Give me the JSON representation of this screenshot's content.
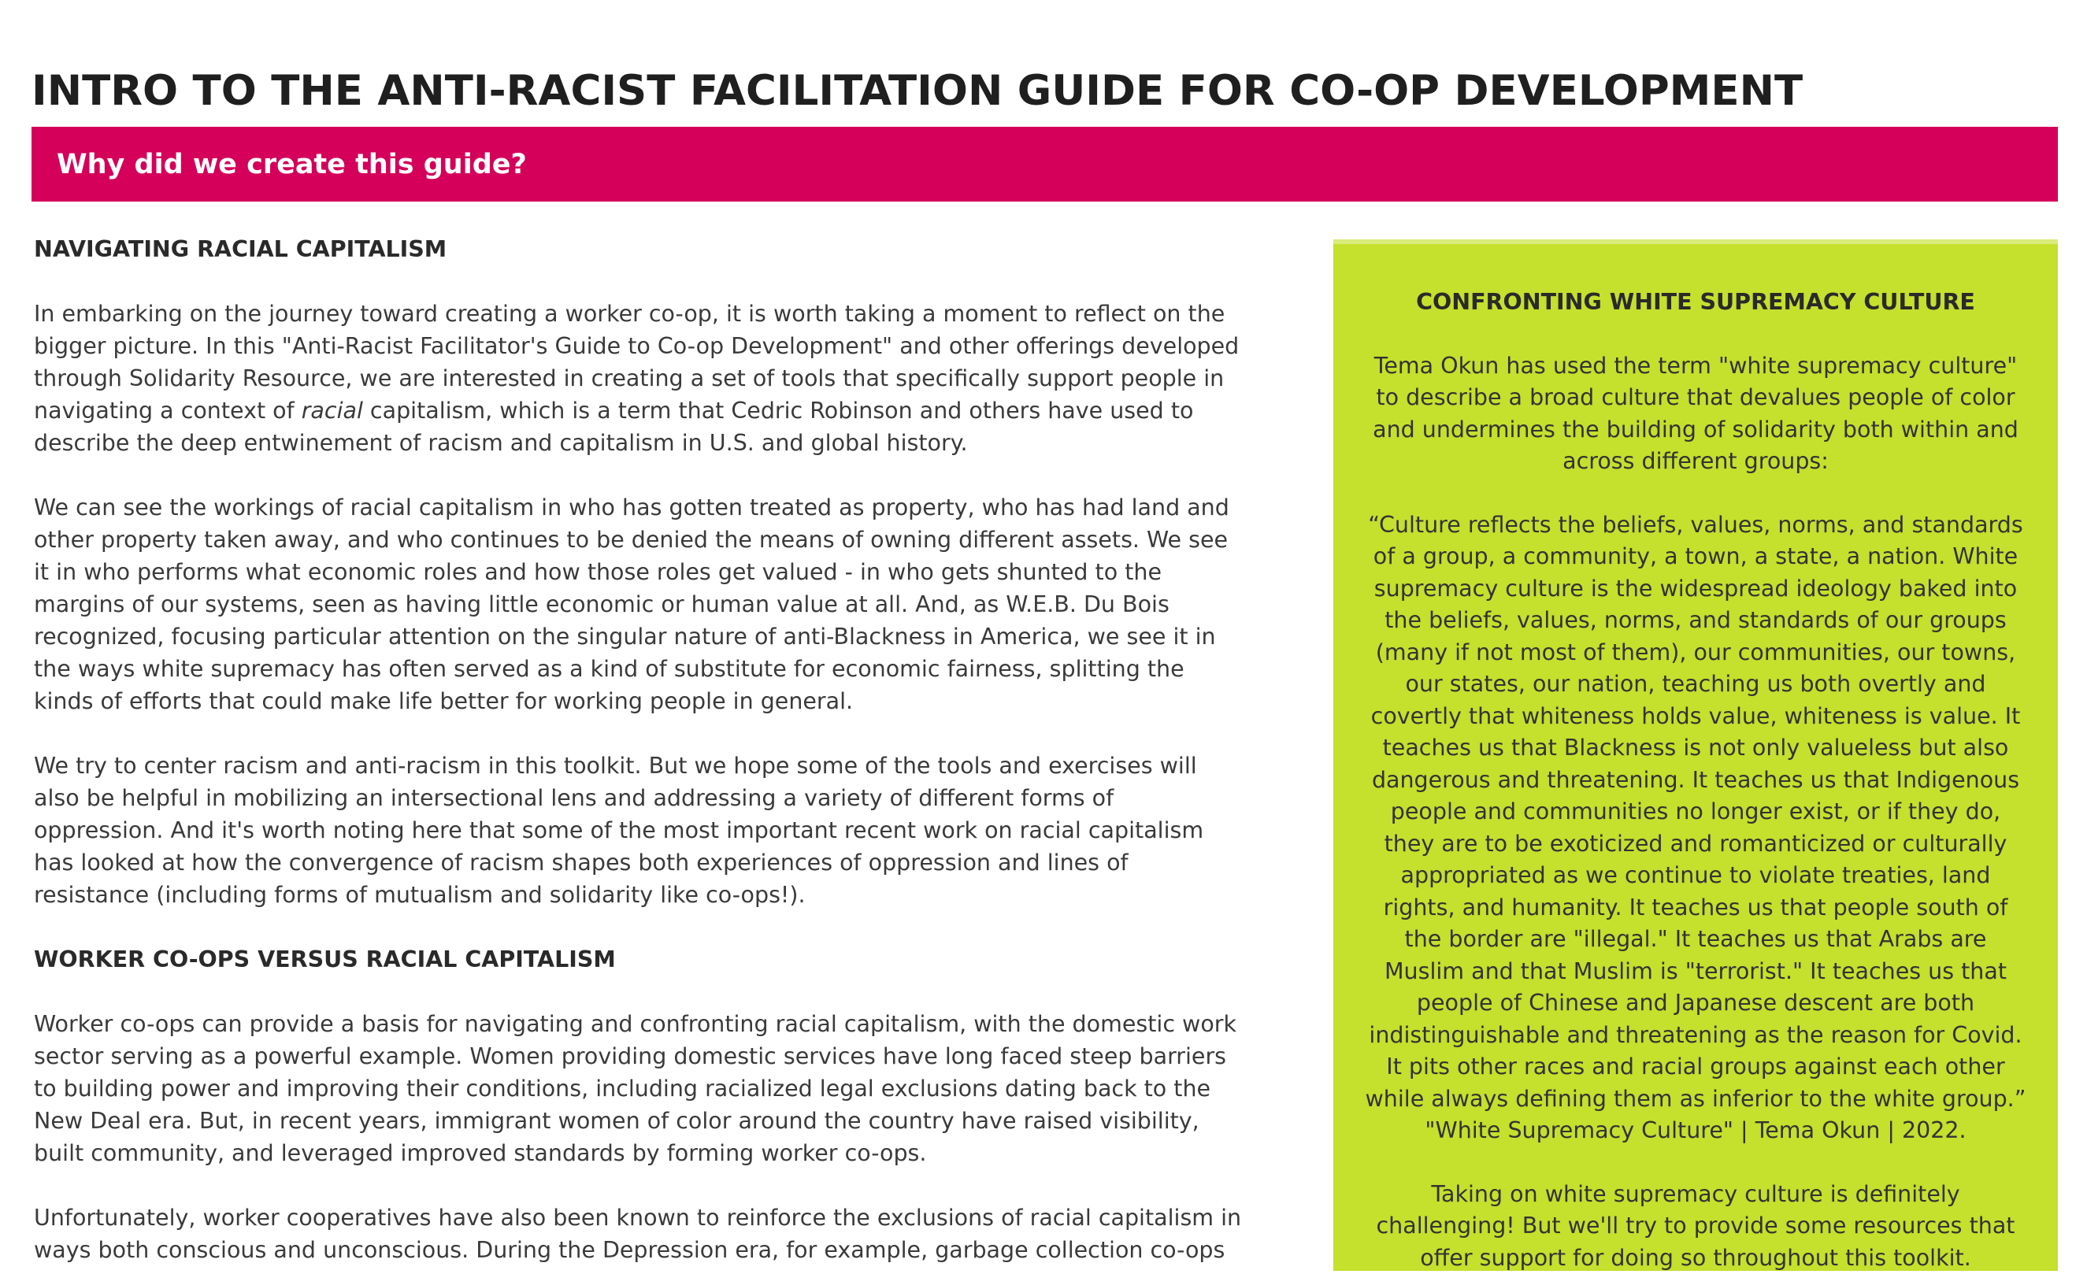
{
  "document": {
    "title": "INTRO TO THE ANTI-RACIST FACILITATION GUIDE FOR CO-OP DEVELOPMENT",
    "banner": "Why did we create this guide?",
    "colors": {
      "banner": "#d4005a",
      "sidebar": "#c5e02d"
    }
  },
  "main": {
    "heading1": "NAVIGATING RACIAL CAPITALISM",
    "p1_before": "In embarking on the journey toward creating a worker co-op, it is worth taking a moment to reflect on the bigger picture. In this \"Anti-Racist Facilitator's Guide to Co-op Development\" and other offerings developed through Solidarity Resource, we are interested in creating a set of tools that specifically support people in navigating a context of ",
    "p1_italic": "racial",
    "p1_after": " capitalism, which is a term that Cedric Robinson and others have used to describe the deep entwinement of racism and capitalism in U.S. and global history.",
    "p2": "We can see the workings of racial capitalism in who has gotten treated as property, who has had land and other property taken away, and who continues to be denied the means of owning different assets. We see it in who performs what economic roles and how those roles get valued - in who gets shunted to the margins of our systems, seen as having little economic or human value at all. And, as W.E.B. Du Bois recognized, focusing particular attention on the singular nature of anti-Blackness in America, we see it in the ways white supremacy has often served as a kind of substitute for economic fairness, splitting the kinds of efforts that could make life better for working people in general.",
    "p3": "We try to center racism and anti-racism in this toolkit. But we hope some of the tools and exercises will also be helpful in mobilizing an intersectional lens and addressing a variety of different forms of oppression. And it's worth noting here that some of the most important recent work on racial capitalism has looked at how the convergence of racism shapes both experiences of oppression and lines of resistance (including forms of mutualism and solidarity like co-ops!).",
    "heading2": "WORKER CO-OPS VERSUS RACIAL CAPITALISM",
    "p4": "Worker co-ops can provide a basis for navigating and confronting racial capitalism, with the domestic work sector serving as a powerful example. Women providing domestic services have long faced steep barriers to building power and improving their conditions, including racialized legal exclusions dating back to the New Deal era. But, in recent years, immigrant women of color around the country have raised visibility, built community, and leveraged improved standards by forming  worker co-ops.",
    "p5": "Unfortunately, worker cooperatives have also been known to reinforce the exclusions of racial capitalism in ways both conscious and unconscious. During the Depression era, for example, garbage collection co-ops"
  },
  "sidebar": {
    "heading": "CONFRONTING WHITE SUPREMACY CULTURE",
    "p1": "Tema Okun has used the term \"white supremacy culture\" to describe a broad culture that devalues people of color and undermines the building of solidarity both within and across different groups:",
    "quote": "“Culture reflects the beliefs, values, norms, and standards of a group, a community, a town, a state, a nation. White supremacy culture is the widespread ideology baked into the beliefs, values, norms, and standards of our groups (many if not most of them), our communities, our towns, our states, our nation, teaching us both overtly and covertly that whiteness holds value, whiteness is value. It teaches us that Blackness is not only valueless but also dangerous and threatening. It teaches us that Indigenous people and communities no longer exist, or if they do, they are to be exoticized and romanticized or culturally appropriated as we continue to violate treaties, land rights, and humanity. It teaches us that people south of the border are \"illegal.\" It teaches us that Arabs are Muslim and that Muslim is \"terrorist.\" It teaches us that people of Chinese and Japanese descent are both indistinguishable and threatening as the reason for Covid. It pits other races and racial groups against each other while always defining them as inferior to the white group.” \"White Supremacy Culture\" | Tema Okun | 2022.",
    "p2": "Taking on white supremacy culture is definitely challenging! But we'll try to provide some resources that offer support for doing so throughout this toolkit."
  }
}
